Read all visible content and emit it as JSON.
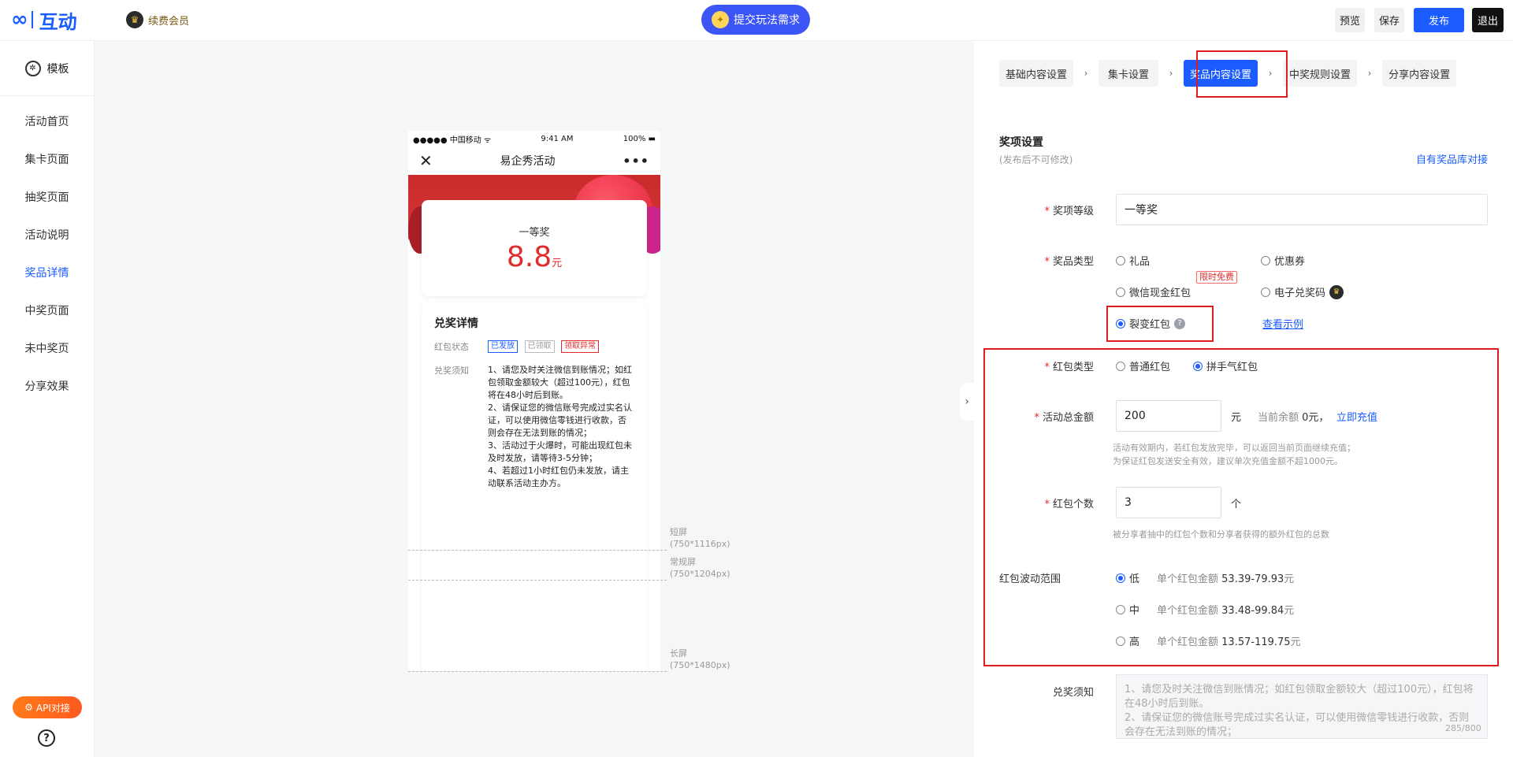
{
  "topbar": {
    "logo_mark": "∞",
    "logo_text": "互动",
    "vip_label": "续费会员",
    "submit_need": "提交玩法需求",
    "preview": "预览",
    "save": "保存",
    "publish": "发布",
    "exit": "退出"
  },
  "sidebar": {
    "template": "模板",
    "items": [
      {
        "label": "活动首页"
      },
      {
        "label": "集卡页面"
      },
      {
        "label": "抽奖页面"
      },
      {
        "label": "活动说明"
      },
      {
        "label": "奖品详情"
      },
      {
        "label": "中奖页面"
      },
      {
        "label": "未中奖页"
      },
      {
        "label": "分享效果"
      }
    ],
    "api": "API对接",
    "help": "?"
  },
  "phone": {
    "carrier": "●●●●● 中国移动 ᯤ",
    "time": "9:41 AM",
    "battery": "100%",
    "title": "易企秀活动",
    "close": "✕",
    "more": "•••",
    "prize_level": "一等奖",
    "prize_amount": "8.8",
    "prize_unit": "元",
    "detail_title": "兑奖详情",
    "status_label": "红包状态",
    "tags": [
      "已发放",
      "已领取",
      "领取异常"
    ],
    "notes_label": "兑奖须知",
    "notes": "1、请您及时关注微信到账情况；如红包领取金额较大（超过100元），红包将在48小时后到账。\n2、请保证您的微信账号完成过实名认证，可以使用微信零钱进行收款，否则会存在无法到账的情况；\n3、活动过于火爆时，可能出现红包未及时发放，请等待3-5分钟；\n4、若超过1小时红包仍未发放，请主动联系活动主办方。"
  },
  "screens": [
    {
      "name": "短屏",
      "size": "(750*1116px)"
    },
    {
      "name": "常规屏",
      "size": "(750*1204px)"
    },
    {
      "name": "长屏",
      "size": "(750*1480px)"
    }
  ],
  "collapse": "›",
  "steps": [
    {
      "label": "基础内容设置"
    },
    {
      "label": "集卡设置"
    },
    {
      "label": "奖品内容设置"
    },
    {
      "label": "中奖规则设置"
    },
    {
      "label": "分享内容设置"
    }
  ],
  "step_arrow": "›",
  "section": {
    "title": "奖项设置",
    "subtitle": "(发布后不可修改)",
    "link": "自有奖品库对接"
  },
  "form": {
    "level_label": "奖项等级",
    "level_value": "一等奖",
    "type_label": "奖品类型",
    "types": {
      "gift": "礼品",
      "coupon": "优惠券",
      "cash": "微信现金红包",
      "code": "电子兑奖码",
      "fission": "裂变红包"
    },
    "free_badge": "限时免费",
    "example_link": "查看示例",
    "rp_type_label": "红包类型",
    "rp_types": {
      "normal": "普通红包",
      "lucky": "拼手气红包"
    },
    "total_label": "活动总金额",
    "total_value": "200",
    "total_unit": "元",
    "balance_prefix": "当前余额",
    "balance_value": "0元，",
    "recharge": "立即充值",
    "total_hint": "活动有效期内，若红包发放完毕，可以返回当前页面继续充值；\n为保证红包发送安全有效，建议单次充值金额不超1000元。",
    "count_label": "红包个数",
    "count_value": "3",
    "count_unit": "个",
    "count_hint": "被分享者抽中的红包个数和分享者获得的额外红包的总数",
    "range_label": "红包波动范围",
    "range_prefix": "单个红包金额",
    "ranges": [
      {
        "level": "低",
        "amount": "53.39-79.93",
        "unit": "元"
      },
      {
        "level": "中",
        "amount": "33.48-99.84",
        "unit": "元"
      },
      {
        "level": "高",
        "amount": "13.57-119.75",
        "unit": "元"
      }
    ],
    "notice_label": "兑奖须知",
    "notice_text": "1、请您及时关注微信到账情况；如红包领取金额较大（超过100元），红包将在48小时后到账。\n2、请保证您的微信账号完成过实名认证，可以使用微信零钱进行收款，否则会存在无法到账的情况；",
    "notice_counter": "285/800"
  },
  "colors": {
    "accent": "#1a5cff",
    "danger": "#e02b2b",
    "highlight_box": "#e01b1b"
  }
}
